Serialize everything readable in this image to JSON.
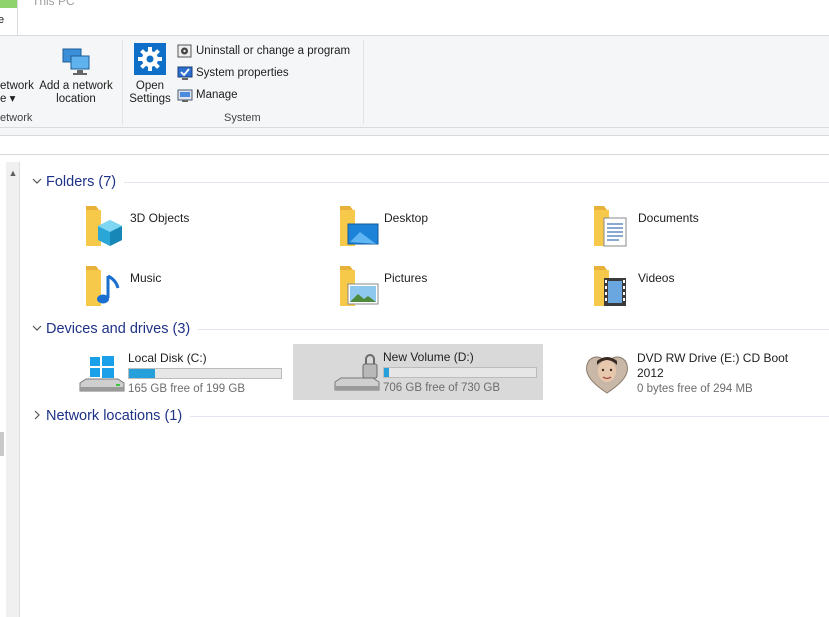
{
  "ribbon": {
    "tabs": [
      {
        "label": "e",
        "active": true
      },
      {
        "label": "This PC",
        "active": false
      }
    ],
    "network_group": {
      "map_drive_label_line1": "etwork",
      "map_drive_label_line2": "e ▾",
      "add_network_location_line1": "Add a network",
      "add_network_location_line2": "location",
      "caption": "etwork"
    },
    "system_group": {
      "open_settings_line1": "Open",
      "open_settings_line2": "Settings",
      "uninstall": "Uninstall or change a program",
      "system_properties": "System properties",
      "manage": "Manage",
      "caption": "System"
    }
  },
  "sections": {
    "folders": {
      "label": "Folders (7)",
      "expanded": true,
      "items": [
        {
          "label": "3D Objects",
          "icon": "3d-objects-folder-icon"
        },
        {
          "label": "Desktop",
          "icon": "desktop-folder-icon"
        },
        {
          "label": "Documents",
          "icon": "documents-folder-icon"
        },
        {
          "label": "Music",
          "icon": "music-folder-icon"
        },
        {
          "label": "Pictures",
          "icon": "pictures-folder-icon"
        },
        {
          "label": "Videos",
          "icon": "videos-folder-icon"
        }
      ]
    },
    "devices": {
      "label": "Devices and drives (3)",
      "expanded": true,
      "drives": [
        {
          "name": "Local Disk (C:)",
          "free_text": "165 GB free of 199 GB",
          "used_fraction": 0.17,
          "selected": false,
          "icon": "windows-drive-icon"
        },
        {
          "name": "New Volume (D:)",
          "free_text": "706 GB free of 730 GB",
          "used_fraction": 0.033,
          "selected": true,
          "icon": "locked-drive-icon"
        },
        {
          "name_line1": "DVD RW Drive (E:) CD Boot",
          "name_line2": "2012",
          "free_text": "0 bytes free of 294 MB",
          "selected": false,
          "icon": "dvd-drive-icon"
        }
      ]
    },
    "network": {
      "label": "Network locations (1)",
      "expanded": false
    }
  },
  "colors": {
    "header_text": "#1e3287",
    "drive_fill": "#26a0da",
    "selection": "#d9d9d9",
    "ribbon_bg": "#f5f6f7",
    "folder_yellow": "#f7c94a"
  }
}
